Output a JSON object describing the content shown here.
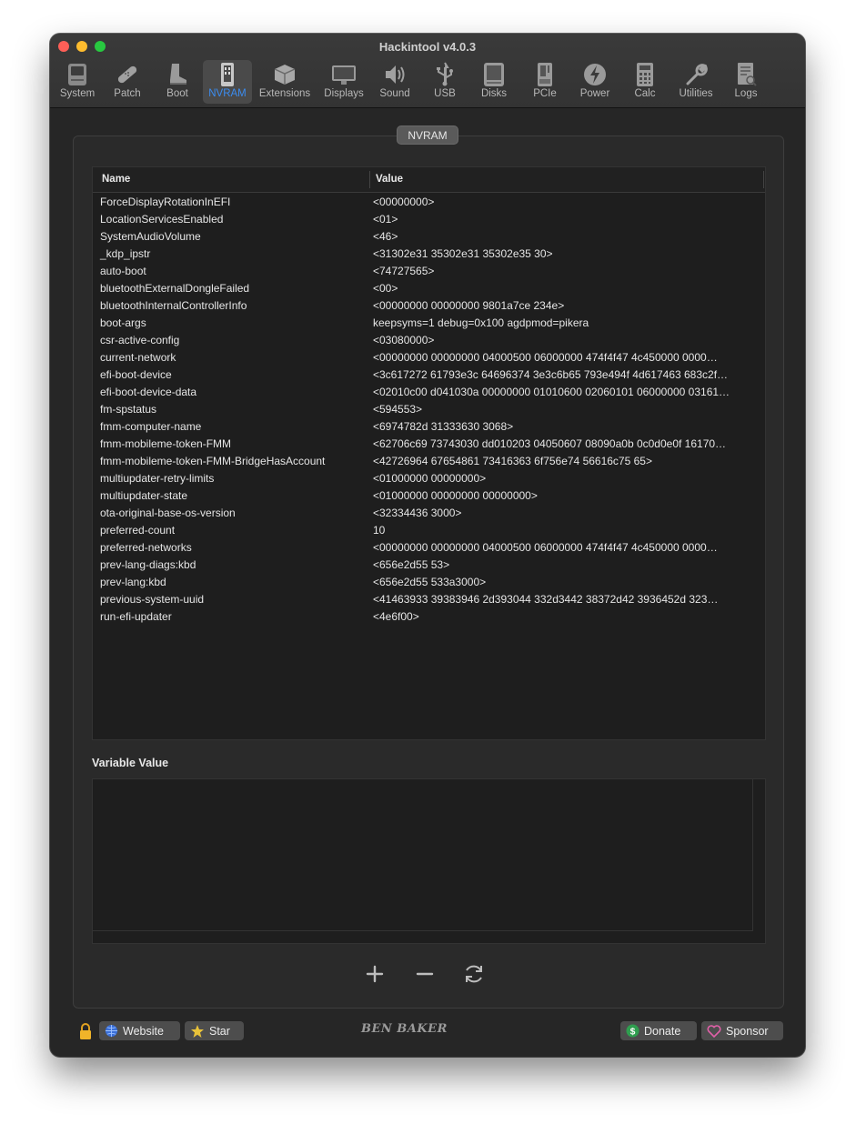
{
  "window": {
    "title": "Hackintool v4.0.3"
  },
  "toolbar": {
    "items": [
      {
        "label": "System",
        "icon": "system-icon"
      },
      {
        "label": "Patch",
        "icon": "patch-icon"
      },
      {
        "label": "Boot",
        "icon": "boot-icon"
      },
      {
        "label": "NVRAM",
        "icon": "nvram-icon",
        "active": true
      },
      {
        "label": "Extensions",
        "icon": "extensions-icon"
      },
      {
        "label": "Displays",
        "icon": "displays-icon"
      },
      {
        "label": "Sound",
        "icon": "sound-icon"
      },
      {
        "label": "USB",
        "icon": "usb-icon"
      },
      {
        "label": "Disks",
        "icon": "disks-icon"
      },
      {
        "label": "PCIe",
        "icon": "pcie-icon"
      },
      {
        "label": "Power",
        "icon": "power-icon"
      },
      {
        "label": "Calc",
        "icon": "calc-icon"
      },
      {
        "label": "Utilities",
        "icon": "utilities-icon"
      },
      {
        "label": "Logs",
        "icon": "logs-icon"
      }
    ]
  },
  "panel": {
    "tab_label": "NVRAM"
  },
  "table": {
    "columns": [
      "Name",
      "Value"
    ],
    "rows": [
      {
        "name": "ForceDisplayRotationInEFI",
        "value": "<00000000>"
      },
      {
        "name": "LocationServicesEnabled",
        "value": "<01>"
      },
      {
        "name": "SystemAudioVolume",
        "value": "<46>"
      },
      {
        "name": "_kdp_ipstr",
        "value": "<31302e31 35302e31 35302e35 30>"
      },
      {
        "name": "auto-boot",
        "value": "<74727565>"
      },
      {
        "name": "bluetoothExternalDongleFailed",
        "value": "<00>"
      },
      {
        "name": "bluetoothInternalControllerInfo",
        "value": "<00000000 00000000 9801a7ce 234e>"
      },
      {
        "name": "boot-args",
        "value": "keepsyms=1 debug=0x100 agdpmod=pikera"
      },
      {
        "name": "csr-active-config",
        "value": "<03080000>"
      },
      {
        "name": "current-network",
        "value": "<00000000 00000000 04000500 06000000 474f4f47 4c450000 0000…"
      },
      {
        "name": "efi-boot-device",
        "value": "<3c617272 61793e3c 64696374 3e3c6b65 793e494f 4d617463 683c2f…"
      },
      {
        "name": "efi-boot-device-data",
        "value": "<02010c00 d041030a 00000000 01010600 02060101 06000000 03161…"
      },
      {
        "name": "fm-spstatus",
        "value": "<594553>"
      },
      {
        "name": "fmm-computer-name",
        "value": "<6974782d 31333630 3068>"
      },
      {
        "name": "fmm-mobileme-token-FMM",
        "value": "<62706c69 73743030 dd010203 04050607 08090a0b 0c0d0e0f 16170…"
      },
      {
        "name": "fmm-mobileme-token-FMM-BridgeHasAccount",
        "value": "<42726964 67654861 73416363 6f756e74 56616c75 65>"
      },
      {
        "name": "multiupdater-retry-limits",
        "value": "<01000000 00000000>"
      },
      {
        "name": "multiupdater-state",
        "value": "<01000000 00000000 00000000>"
      },
      {
        "name": "ota-original-base-os-version",
        "value": "<32334436 3000>"
      },
      {
        "name": "preferred-count",
        "value": "10"
      },
      {
        "name": "preferred-networks",
        "value": "<00000000 00000000 04000500 06000000 474f4f47 4c450000 0000…"
      },
      {
        "name": "prev-lang-diags:kbd",
        "value": "<656e2d55 53>"
      },
      {
        "name": "prev-lang:kbd",
        "value": "<656e2d55 533a3000>"
      },
      {
        "name": "previous-system-uuid",
        "value": "<41463933 39383946 2d393044 332d3442 38372d42 3936452d 323…"
      },
      {
        "name": "run-efi-updater",
        "value": "<4e6f00>"
      }
    ]
  },
  "variable_value": {
    "label": "Variable Value",
    "value": ""
  },
  "actions": {
    "add": "plus-icon",
    "remove": "minus-icon",
    "refresh": "refresh-icon"
  },
  "footer": {
    "website_label": "Website",
    "star_label": "Star",
    "brand": "BEN BAKER",
    "donate_label": "Donate",
    "sponsor_label": "Sponsor"
  },
  "colors": {
    "accent": "#3b8cf0",
    "window_bg": "#262626",
    "table_bg": "#1e1e1e"
  }
}
